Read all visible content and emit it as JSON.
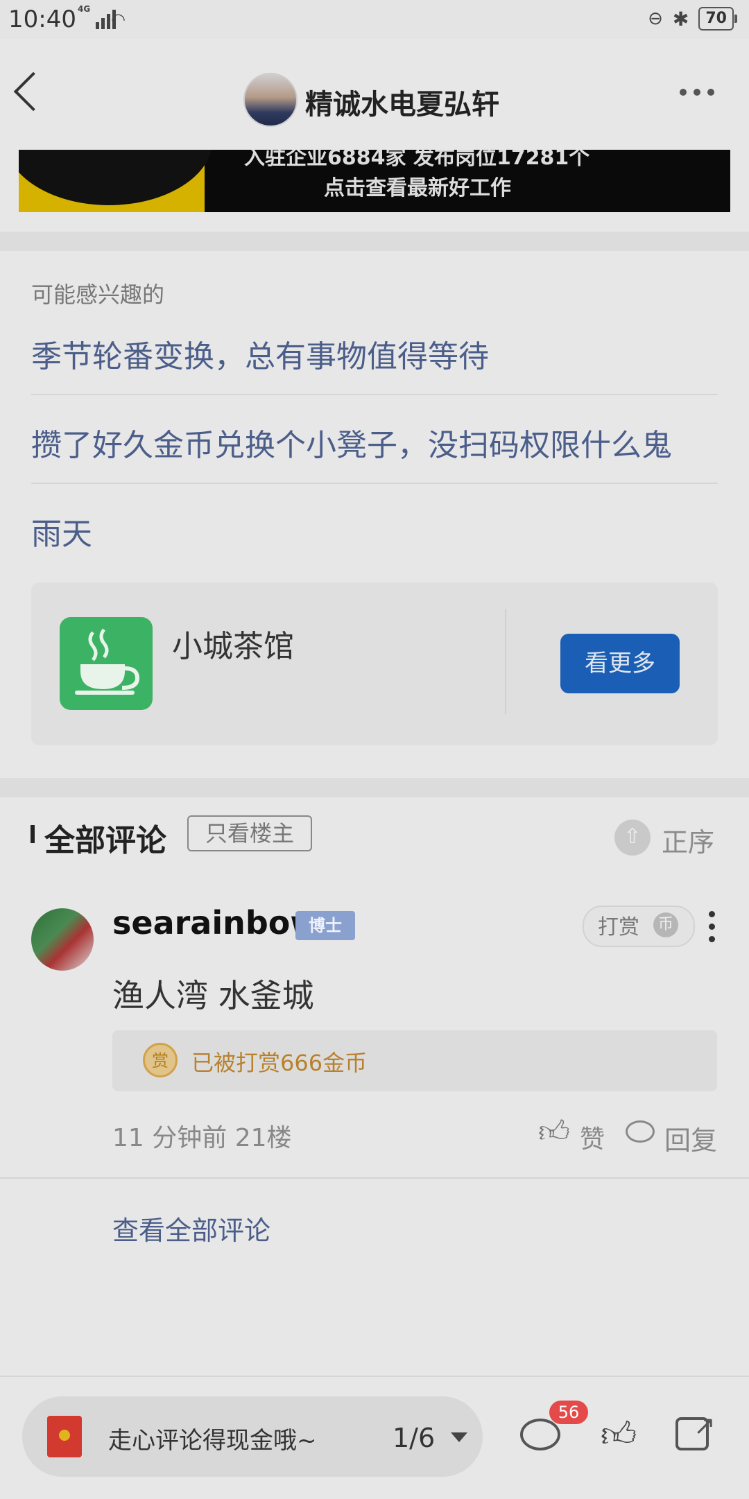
{
  "status": {
    "time": "10:40",
    "network": "4G",
    "battery": "70"
  },
  "header": {
    "title": "精诚水电夏弘轩"
  },
  "banner": {
    "line1": "入驻企业6884家 发布岗位17281个",
    "line2": "点击查看最新好工作"
  },
  "interest": {
    "label": "可能感兴趣的",
    "links": [
      "季节轮番变换，总有事物值得等待",
      "攒了好久金币兑换个小凳子，没扫码权限什么鬼",
      "雨天"
    ]
  },
  "community": {
    "name": "小城茶馆",
    "button": "看更多"
  },
  "comments_section": {
    "title": "全部评论",
    "filter": "只看楼主",
    "sort": "正序"
  },
  "comment": {
    "user": "searainbow",
    "badge": "博士",
    "tip_label": "打赏",
    "text": "渔人湾   水釜城",
    "reward_icon_label": "赏",
    "reward": "已被打赏666金币",
    "meta": "11 分钟前  21楼",
    "like": "赞",
    "reply": "回复"
  },
  "see_all": "查看全部评论",
  "bottom": {
    "input_placeholder": "走心评论得现金哦~",
    "page": "1/6",
    "comment_count": "56"
  },
  "colors": {
    "accent": "#1a5fb5",
    "link": "#4b5e8a",
    "reward": "#b8812c",
    "badge": "#8aa1cf",
    "notify": "#e44a4a"
  }
}
